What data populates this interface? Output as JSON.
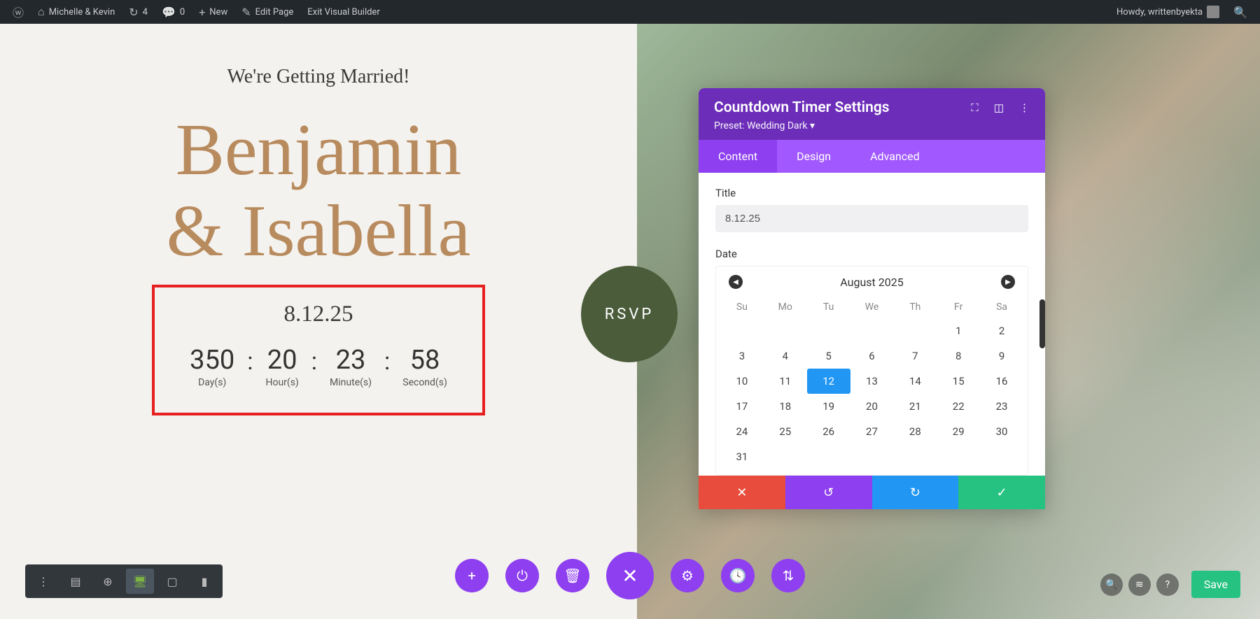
{
  "adminbar": {
    "site_name": "Michelle & Kevin",
    "updates": "4",
    "comments": "0",
    "new_label": "New",
    "edit_page": "Edit Page",
    "exit_vb": "Exit Visual Builder",
    "howdy": "Howdy, writtenbyekta"
  },
  "hero": {
    "subtitle": "We're Getting Married!",
    "name1": "Benjamin",
    "amp": "&",
    "name2": "Isabella",
    "rsvp": "RSVP"
  },
  "countdown": {
    "date_label": "8.12.25",
    "days": "350",
    "days_label": "Day(s)",
    "hours": "20",
    "hours_label": "Hour(s)",
    "minutes": "23",
    "minutes_label": "Minute(s)",
    "seconds": "58",
    "seconds_label": "Second(s)"
  },
  "settings": {
    "panel_title": "Countdown Timer Settings",
    "preset": "Preset: Wedding Dark ▾",
    "tabs": {
      "content": "Content",
      "design": "Design",
      "advanced": "Advanced"
    },
    "title_label": "Title",
    "title_value": "8.12.25",
    "date_label": "Date",
    "calendar": {
      "month": "August 2025",
      "dow": [
        "Su",
        "Mo",
        "Tu",
        "We",
        "Th",
        "Fr",
        "Sa"
      ],
      "leading_blanks": 5,
      "days": 31,
      "selected": 12
    }
  },
  "bottom": {
    "save": "Save"
  }
}
